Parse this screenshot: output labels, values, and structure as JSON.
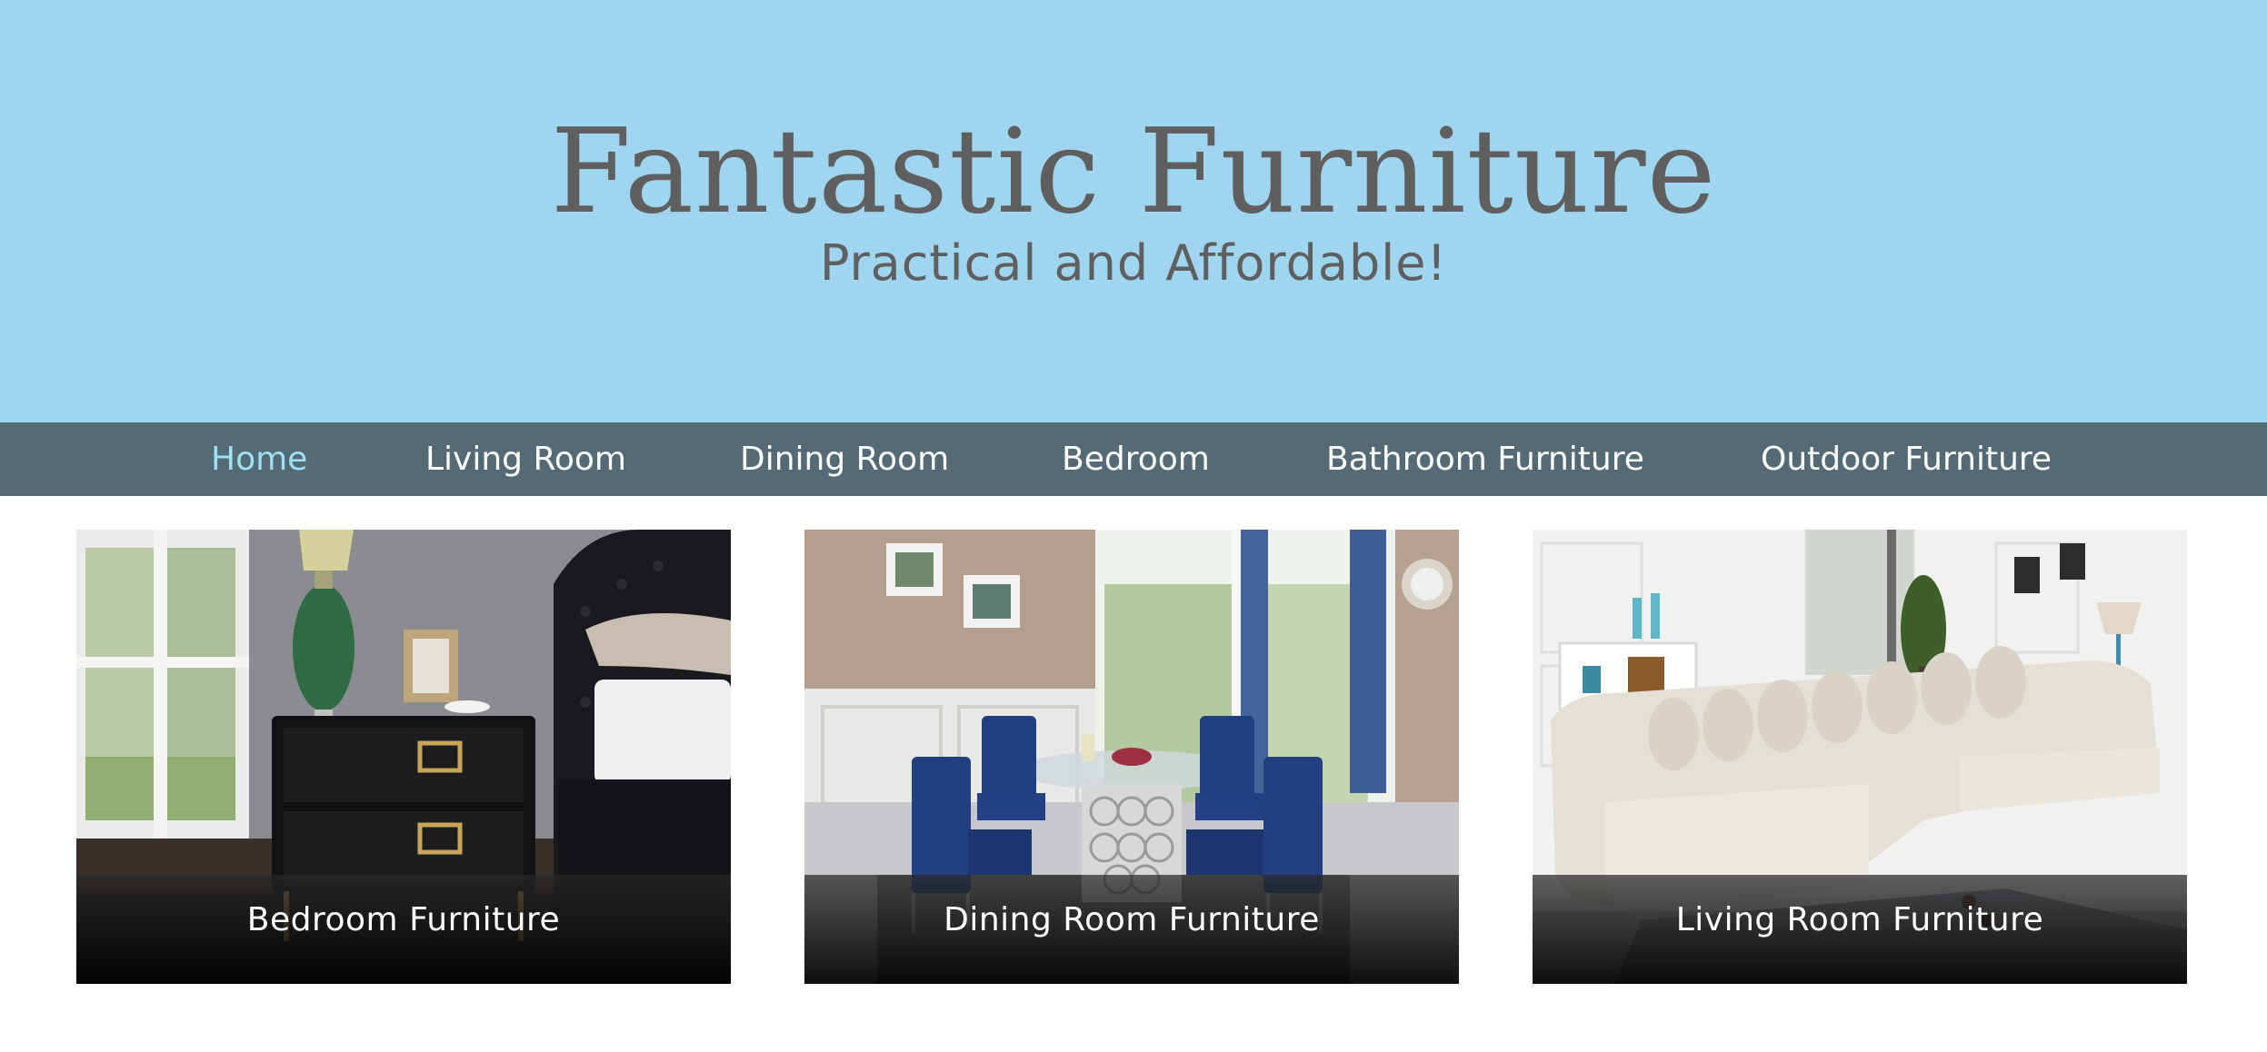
{
  "header": {
    "title": "Fantastic Furniture",
    "tagline": "Practical and Affordable!"
  },
  "nav": {
    "items": [
      {
        "label": "Home",
        "active": true
      },
      {
        "label": "Living Room"
      },
      {
        "label": "Dining Room"
      },
      {
        "label": "Bedroom"
      },
      {
        "label": "Bathroom Furniture"
      },
      {
        "label": "Outdoor Furniture"
      }
    ]
  },
  "cards": [
    {
      "caption": "Bedroom Furniture"
    },
    {
      "caption": "Dining Room Furniture"
    },
    {
      "caption": "Living Room Furniture"
    }
  ],
  "colors": {
    "header_bg": "#9fd5ee",
    "nav_bg": "#546a75",
    "nav_active": "#9fe0f7",
    "title_text": "#5f5f5f"
  }
}
